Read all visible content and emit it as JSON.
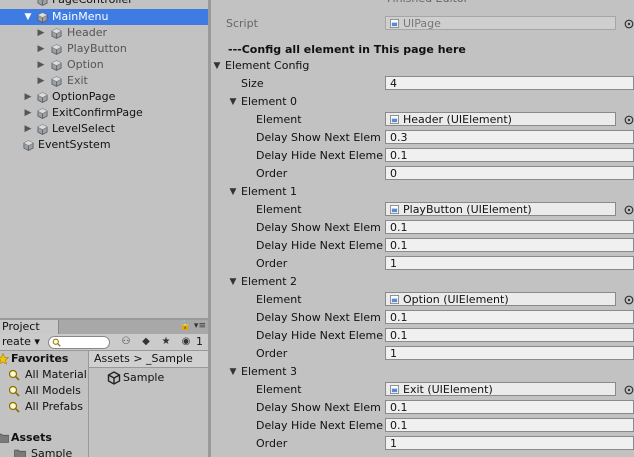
{
  "hierarchy": {
    "items": [
      {
        "label": "PageController"
      },
      {
        "label": "MainMenu"
      },
      {
        "label": "Header"
      },
      {
        "label": "PlayButton"
      },
      {
        "label": "Option"
      },
      {
        "label": "Exit"
      },
      {
        "label": "OptionPage"
      },
      {
        "label": "ExitConfirmPage"
      },
      {
        "label": "LevelSelect"
      },
      {
        "label": "EventSystem"
      }
    ]
  },
  "project": {
    "tab_label": "Project",
    "create_label": "reate",
    "filter_count": "1",
    "favorites": {
      "title": "Favorites",
      "items": [
        {
          "label": "All Material"
        },
        {
          "label": "All Models"
        },
        {
          "label": "All Prefabs"
        }
      ]
    },
    "assets": {
      "title": "Assets",
      "items": [
        {
          "label": "Sample"
        }
      ]
    },
    "breadcrumb": {
      "root": "Assets",
      "sep": ">",
      "current": "_Sample"
    },
    "files": [
      {
        "label": "Sample"
      }
    ]
  },
  "inspector": {
    "editor_label": "Finished Editor",
    "script_label": "Script",
    "script_value": "UIPage",
    "config_header": "---Config all element in This page here",
    "element_config_label": "Element Config",
    "size_label": "Size",
    "size_value": "4",
    "field_labels": {
      "element": "Element",
      "delay_show": "Delay Show Next Elem",
      "delay_hide": "Delay Hide Next Eleme",
      "order": "Order"
    },
    "elements": [
      {
        "title": "Element 0",
        "element": "Header (UIElement)",
        "delay_show": "0.3",
        "delay_hide": "0.1",
        "order": "0"
      },
      {
        "title": "Element 1",
        "element": "PlayButton (UIElement)",
        "delay_show": "0.1",
        "delay_hide": "0.1",
        "order": "1"
      },
      {
        "title": "Element 2",
        "element": "Option (UIElement)",
        "delay_show": "0.1",
        "delay_hide": "0.1",
        "order": "1"
      },
      {
        "title": "Element 3",
        "element": "Exit (UIElement)",
        "delay_show": "0.1",
        "delay_hide": "0.1",
        "order": "1"
      }
    ]
  }
}
